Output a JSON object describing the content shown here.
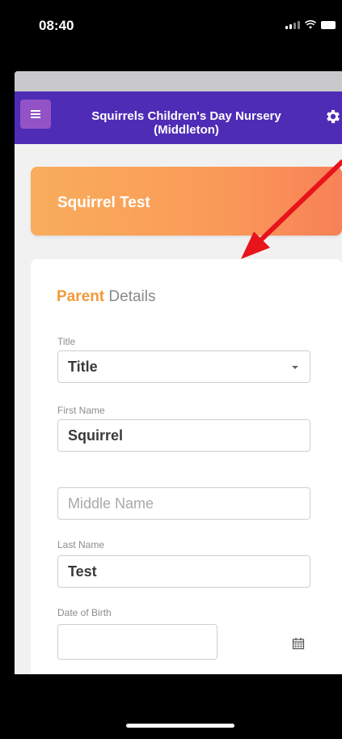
{
  "status_bar": {
    "time": "08:40"
  },
  "header": {
    "title": "Squirrels Children's Day Nursery (Middleton)",
    "menu_icon": "hamburger-menu-icon",
    "settings_icon": "gear-icon"
  },
  "child": {
    "name": "Squirrel Test"
  },
  "form": {
    "section_title_accent": "Parent",
    "section_title_rest": "Details",
    "title_label": "Title",
    "title_value": "Title",
    "first_name_label": "First Name",
    "first_name_value": "Squirrel",
    "middle_name_placeholder": "Middle Name",
    "last_name_label": "Last Name",
    "last_name_value": "Test",
    "dob_label": "Date of Birth",
    "dob_value": ""
  },
  "colors": {
    "header_bg": "#4f2cb6",
    "menu_button": "#9353c7",
    "banner_start": "#f9ad5c",
    "banner_end": "#f88157",
    "accent_text": "#f29a3a",
    "annotation_arrow": "#e8141b"
  }
}
